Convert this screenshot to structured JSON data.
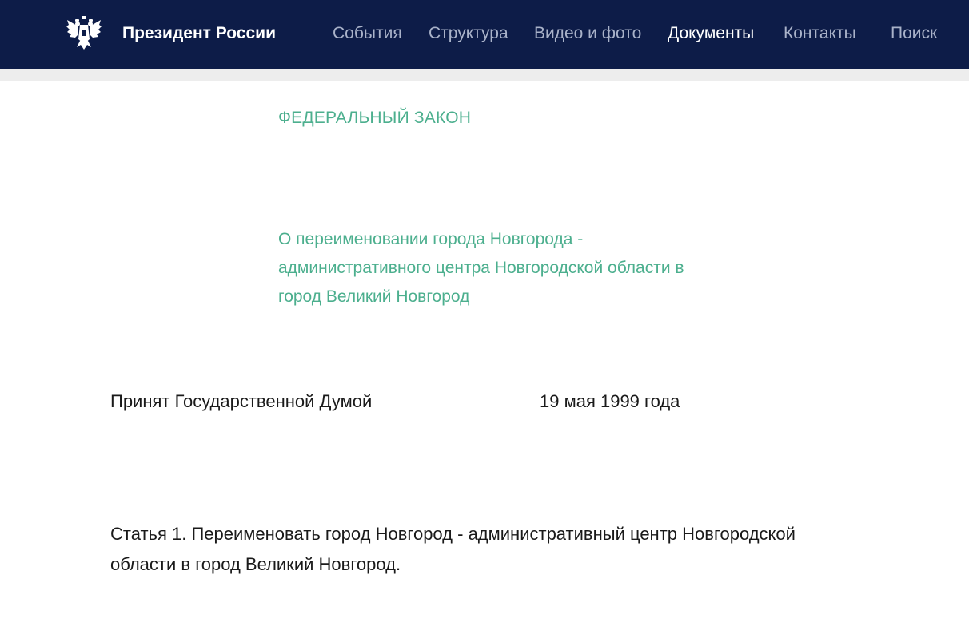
{
  "header": {
    "logo_icon": "double-headed-eagle-emblem-icon",
    "site_title": "Президент России",
    "nav": [
      {
        "label": "События",
        "active": false
      },
      {
        "label": "Структура",
        "active": false
      },
      {
        "label": "Видео и фото",
        "active": false
      },
      {
        "label": "Документы",
        "active": true
      },
      {
        "label": "Контакты",
        "active": false
      },
      {
        "label": "Поиск",
        "active": false
      }
    ]
  },
  "document": {
    "type": "ФЕДЕРАЛЬНЫЙ ЗАКОН",
    "title_lines": [
      "О переименовании города Новгорода -",
      "административного центра Новгородской области в",
      "город Великий Новгород"
    ],
    "adopted_label": "Принят Государственной Думой",
    "adopted_date": "19 мая 1999 года",
    "article_lines": [
      "Статья 1. Переименовать город Новгород - административный центр Новгородской",
      "области в город Великий Новгород."
    ]
  },
  "colors": {
    "header_bg": "#0d1c48",
    "nav_text": "#a9b2c9",
    "nav_active": "#ffffff",
    "accent_green": "#4caf8e",
    "body_text": "#1a1a1a"
  }
}
